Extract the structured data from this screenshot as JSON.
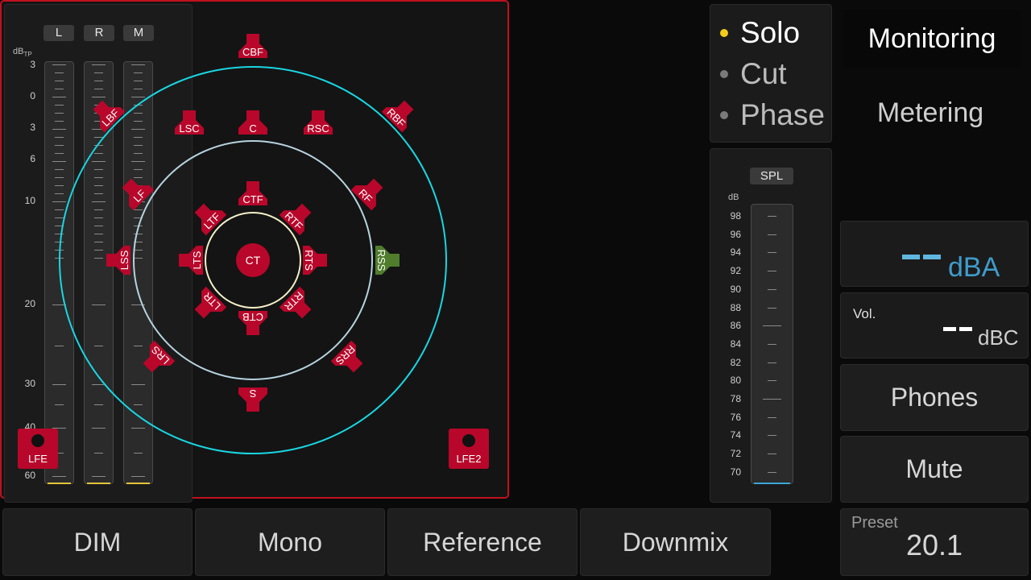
{
  "meters": {
    "channels": [
      "L",
      "R",
      "M"
    ],
    "unit_main": "dB",
    "unit_sub": "TP",
    "scale": [
      "3",
      "0",
      "3",
      "6",
      "10",
      "20",
      "30",
      "40",
      "60"
    ]
  },
  "speakers": [
    {
      "label": "CBF",
      "ring": "outer",
      "state": "normal"
    },
    {
      "label": "LBF",
      "ring": "outer",
      "state": "normal"
    },
    {
      "label": "RBF",
      "ring": "outer",
      "state": "normal"
    },
    {
      "label": "LSC",
      "ring": "outer",
      "state": "normal"
    },
    {
      "label": "C",
      "ring": "outer",
      "state": "normal"
    },
    {
      "label": "RSC",
      "ring": "outer",
      "state": "normal"
    },
    {
      "label": "LF",
      "ring": "middle",
      "state": "normal"
    },
    {
      "label": "RF",
      "ring": "middle",
      "state": "normal"
    },
    {
      "label": "LSS",
      "ring": "middle",
      "state": "normal"
    },
    {
      "label": "RSS",
      "ring": "middle",
      "state": "solo"
    },
    {
      "label": "LRS",
      "ring": "middle",
      "state": "normal"
    },
    {
      "label": "RRS",
      "ring": "middle",
      "state": "normal"
    },
    {
      "label": "S",
      "ring": "middle",
      "state": "normal"
    },
    {
      "label": "CTF",
      "ring": "inner",
      "state": "normal"
    },
    {
      "label": "LTF",
      "ring": "inner",
      "state": "normal"
    },
    {
      "label": "RTF",
      "ring": "inner",
      "state": "normal"
    },
    {
      "label": "LTS",
      "ring": "inner",
      "state": "normal"
    },
    {
      "label": "RTS",
      "ring": "inner",
      "state": "normal"
    },
    {
      "label": "LTR",
      "ring": "inner",
      "state": "normal"
    },
    {
      "label": "RTR",
      "ring": "inner",
      "state": "normal"
    },
    {
      "label": "CTB",
      "ring": "inner",
      "state": "normal"
    },
    {
      "label": "CT",
      "ring": "center",
      "state": "normal"
    }
  ],
  "lfe": [
    "LFE",
    "LFE2"
  ],
  "modes": [
    {
      "label": "Solo",
      "active": true
    },
    {
      "label": "Cut",
      "active": false
    },
    {
      "label": "Phase",
      "active": false
    }
  ],
  "spl": {
    "button": "SPL",
    "unit": "dB",
    "scale": [
      "98",
      "96",
      "94",
      "92",
      "90",
      "88",
      "86",
      "84",
      "82",
      "80",
      "78",
      "76",
      "74",
      "72",
      "70"
    ]
  },
  "tabs": {
    "monitoring": "Monitoring",
    "metering": "Metering"
  },
  "readouts": {
    "dba_unit": "dBA",
    "vol_label": "Vol.",
    "dbc_unit": "dBC"
  },
  "buttons": {
    "phones": "Phones",
    "mute": "Mute",
    "dim": "DIM",
    "mono": "Mono",
    "reference": "Reference",
    "downmix": "Downmix"
  },
  "preset": {
    "label": "Preset",
    "value": "20.1"
  },
  "colors": {
    "speaker": "#b8072a",
    "speaker_solo": "#4f7d2c",
    "panel_border": "#c0101e",
    "outer_ring": "#19d6e2",
    "middle_ring": "#b6d3df",
    "inner_ring": "#f3efc8",
    "solo_dot": "#f2cb1c",
    "dba_color": "#3f9ccc"
  }
}
